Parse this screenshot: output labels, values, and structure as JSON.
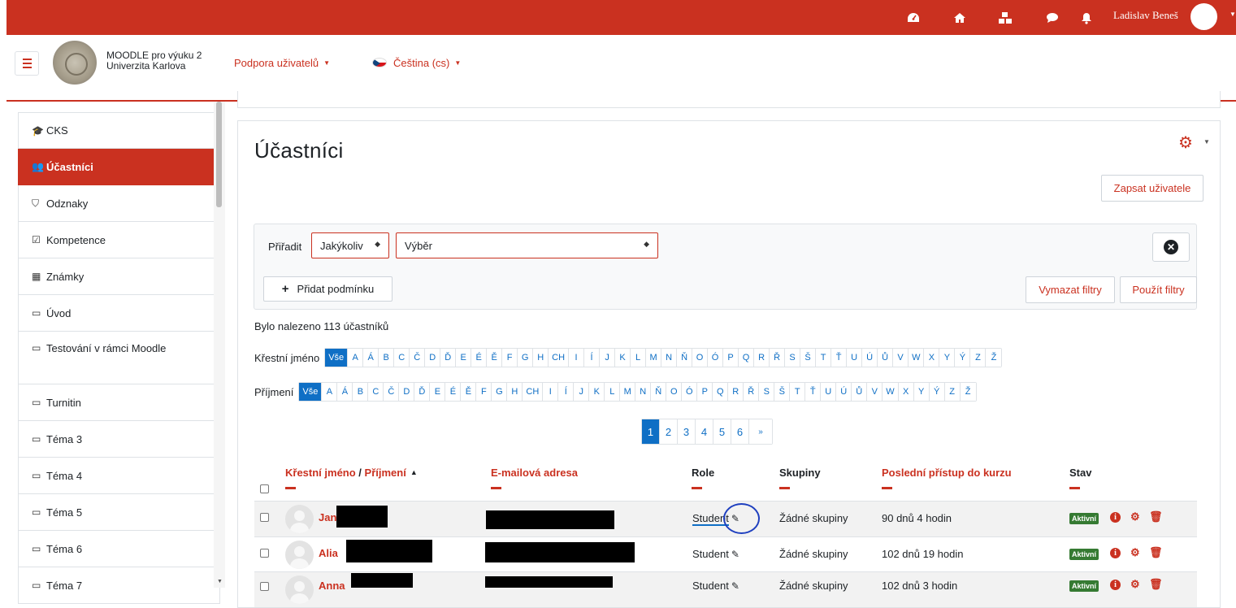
{
  "topbar": {
    "user_name": "Ladislav Beneš",
    "icons": [
      "dashboard-icon",
      "home-icon",
      "cubes-icon",
      "messages-icon",
      "notifications-icon"
    ],
    "accent": "#ca3120"
  },
  "navbar": {
    "site_line1": "MOODLE pro výuku 2",
    "site_line2": "Univerzita Karlova",
    "support_link": "Podpora uživatelů",
    "language_link": "Čeština (cs)"
  },
  "sidebar": {
    "items": [
      {
        "label": "CKS",
        "icon": "graduation-cap-icon"
      },
      {
        "label": "Účastníci",
        "icon": "users-icon",
        "active": true
      },
      {
        "label": "Odznaky",
        "icon": "shield-icon"
      },
      {
        "label": "Kompetence",
        "icon": "checkbox-icon"
      },
      {
        "label": "Známky",
        "icon": "table-icon"
      },
      {
        "label": "Úvod",
        "icon": "folder-icon"
      },
      {
        "label": "Testování v rámci Moodle",
        "icon": "folder-icon"
      },
      {
        "label": "Turnitin",
        "icon": "folder-icon"
      },
      {
        "label": "Téma 3",
        "icon": "folder-icon"
      },
      {
        "label": "Téma 4",
        "icon": "folder-icon"
      },
      {
        "label": "Téma 5",
        "icon": "folder-icon"
      },
      {
        "label": "Téma 6",
        "icon": "folder-icon"
      },
      {
        "label": "Téma 7",
        "icon": "folder-icon"
      }
    ]
  },
  "main": {
    "title": "Účastníci",
    "enrol_button": "Zapsat uživatele",
    "filter": {
      "assign_label": "Přiřadit",
      "match_value": "Jakýkoliv",
      "selection_value": "Výběr",
      "add_condition": "Přidat podmínku",
      "clear_filters": "Vymazat filtry",
      "apply_filters": "Použít filtry"
    },
    "found_text": "Bylo nalezeno 113 účastníků",
    "firstname_label": "Křestní jméno",
    "lastname_label": "Příjmení",
    "initials_all": "Vše",
    "letters": [
      "A",
      "Á",
      "B",
      "C",
      "Č",
      "D",
      "Ď",
      "E",
      "É",
      "Ě",
      "F",
      "G",
      "H",
      "CH",
      "I",
      "Í",
      "J",
      "K",
      "L",
      "M",
      "N",
      "Ň",
      "O",
      "Ó",
      "P",
      "Q",
      "R",
      "Ř",
      "S",
      "Š",
      "T",
      "Ť",
      "U",
      "Ú",
      "Ů",
      "V",
      "W",
      "X",
      "Y",
      "Ý",
      "Z",
      "Ž"
    ],
    "pages": [
      "1",
      "2",
      "3",
      "4",
      "5",
      "6",
      "»"
    ],
    "current_page": "1",
    "table": {
      "col_firstname": "Křestní jméno",
      "col_slash": " / ",
      "col_lastname": "Příjmení",
      "col_email": "E-mailová adresa",
      "col_role": "Role",
      "col_groups": "Skupiny",
      "col_lastaccess": "Poslední přístup do kurzu",
      "col_status": "Stav",
      "rows": [
        {
          "first_name": "Jan",
          "role": "Student",
          "groups": "Žádné skupiny",
          "last_access": "90 dnů 4 hodin",
          "status": "Aktivní"
        },
        {
          "first_name": "Alia",
          "role": "Student",
          "groups": "Žádné skupiny",
          "last_access": "102 dnů 19 hodin",
          "status": "Aktivní"
        },
        {
          "first_name": "Anna",
          "role": "Student",
          "groups": "Žádné skupiny",
          "last_access": "102 dnů 3 hodin",
          "status": "Aktivní"
        }
      ]
    }
  }
}
